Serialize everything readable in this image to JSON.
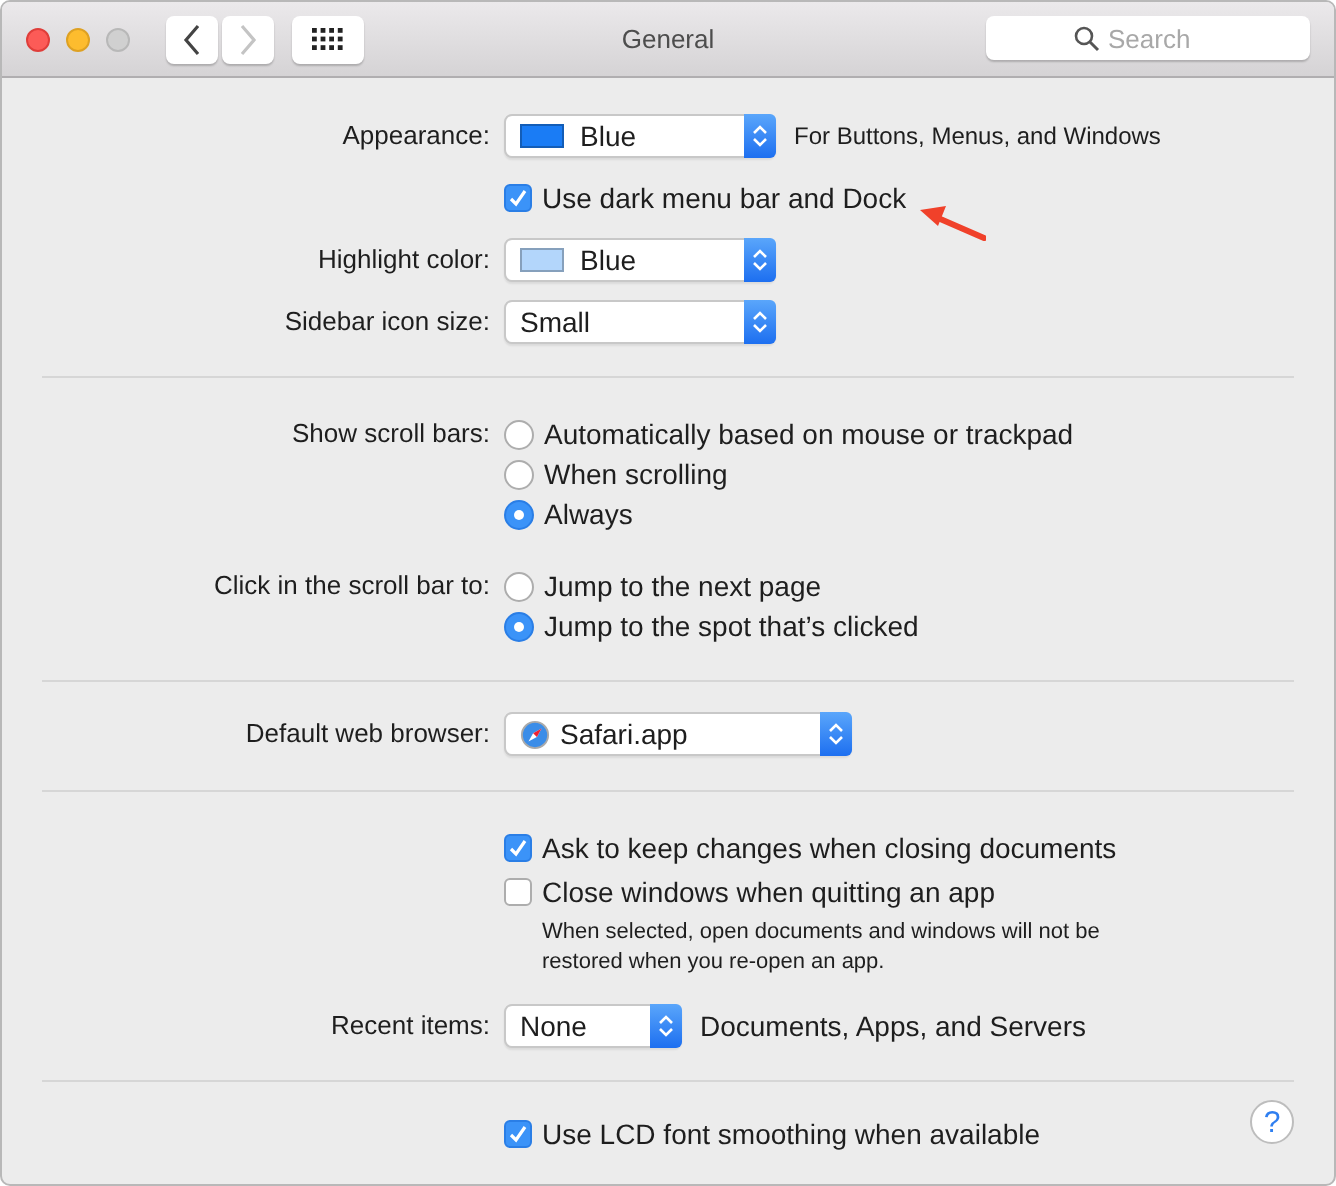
{
  "window": {
    "title": "General",
    "search": {
      "placeholder": "Search"
    },
    "nav": [
      {
        "kind": "back",
        "disabled": false
      },
      {
        "kind": "forward",
        "disabled": true
      }
    ]
  },
  "sections": [
    {
      "rows": [
        {
          "kind": "popup",
          "label": "Appearance:",
          "value": "Blue",
          "color": "#1a7cf5",
          "note": "For Buttons, Menus, and Windows"
        },
        {
          "kind": "checkbox",
          "text": "Use dark menu bar and Dock",
          "checked": true,
          "pointer": true
        },
        {
          "kind": "popup",
          "label": "Highlight color:",
          "value": "Blue",
          "color": "#b3d6fb"
        },
        {
          "kind": "popup",
          "label": "Sidebar icon size:",
          "value": "Small"
        }
      ]
    },
    {
      "rows": [
        {
          "kind": "radio",
          "label": "Show scroll bars:",
          "options": [
            {
              "text": "Automatically based on mouse or trackpad",
              "selected": false
            },
            {
              "text": "When scrolling",
              "selected": false
            },
            {
              "text": "Always",
              "selected": true
            }
          ]
        },
        {
          "kind": "radio",
          "label": "Click in the scroll bar to:",
          "options": [
            {
              "text": "Jump to the next page",
              "selected": false
            },
            {
              "text": "Jump to the spot that’s clicked",
              "selected": true
            }
          ]
        }
      ]
    },
    {
      "rows": [
        {
          "kind": "popup",
          "label": "Default web browser:",
          "value": "Safari.app",
          "app_icon": true
        }
      ]
    },
    {
      "rows": [
        {
          "kind": "checkbox",
          "text": "Ask to keep changes when closing documents",
          "checked": true
        },
        {
          "kind": "checkbox",
          "text": "Close windows when quitting an app",
          "checked": false
        },
        {
          "kind": "note",
          "text": "When selected, open documents and windows will not be restored when you re-open an app."
        },
        {
          "kind": "popup",
          "label": "Recent items:",
          "value": "None",
          "note": "Documents, Apps, and Servers"
        }
      ]
    },
    {
      "rows": [
        {
          "kind": "checkbox",
          "text": "Use LCD font smoothing when available",
          "checked": true
        }
      ],
      "help": "?"
    }
  ]
}
